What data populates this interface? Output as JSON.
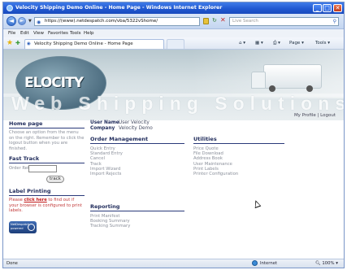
{
  "window": {
    "title": "Velocity Shipping Demo Online - Home Page - Windows Internet Explorer",
    "minimize": "_",
    "maximize": "□",
    "close": "✕"
  },
  "nav": {
    "back_icon": "◄",
    "forward_icon": "►",
    "address": "https://(www).netdespatch.com/vba/5322vShome/",
    "search_placeholder": "Live Search",
    "icons": [
      "ie-logo-icon",
      "back-icon",
      "forward-icon",
      "lock-icon",
      "refresh-icon",
      "stop-icon",
      "search-icon"
    ]
  },
  "menubar": [
    "File",
    "Edit",
    "View",
    "Favorites",
    "Tools",
    "Help"
  ],
  "favorites_bar": {
    "tab_title": "Velocity Shipping Demo Online - Home Page",
    "commands": [
      "Page ▾",
      "Tools ▾"
    ]
  },
  "banner": {
    "logo_text": "ELOCITY",
    "tagline": "Web Shipping Solutions"
  },
  "profile_links": {
    "my_profile": "My Profile",
    "separator": " | ",
    "logout": "Logout"
  },
  "sidebar": {
    "home_heading": "Home page",
    "home_text": "Choose an option from the menu on the right. Remember to click the logout button when you are finished.",
    "fast_track_heading": "Fast Track",
    "order_ref_label": "Order Ref.",
    "track_button": "track",
    "label_printing_heading": "Label Printing",
    "label_text_before": "Please ",
    "label_link": "click here",
    "label_text_after": " to find out if your browser is configured to print labels.",
    "badge_text": "NetDespatch powered"
  },
  "main": {
    "user_name_label": "User Name",
    "user_name_value": "User Velocity",
    "company_label": "Company",
    "company_value": "Velocity Demo",
    "order_management": {
      "heading": "Order Management",
      "items": [
        "Quick Entry",
        "Standard Entry",
        "Cancel",
        "Track",
        "Import Wizard",
        "Import Rejects"
      ]
    },
    "utilities": {
      "heading": "Utilities",
      "items": [
        "Price Quote",
        "File Download",
        "Address Book",
        "User Maintenance",
        "Print Labels",
        "Printer Configuration"
      ]
    },
    "reporting": {
      "heading": "Reporting",
      "items": [
        "Print Manifest",
        "Booking Summary",
        "Tracking Summary"
      ]
    }
  },
  "status": {
    "text": "Done",
    "zone": "Internet",
    "zoom": "100%"
  },
  "colors": {
    "title_bar": "#1f56cf",
    "heading": "#1e2a5a",
    "menu_text": "#8a8f9a",
    "link_red": "#c21a1a"
  }
}
